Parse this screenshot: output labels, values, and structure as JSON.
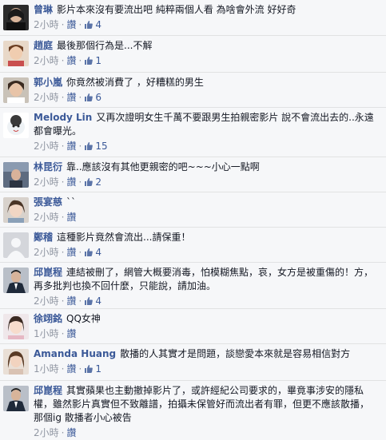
{
  "comments": [
    {
      "author": "曾琳",
      "text": "影片本來沒有要流出吧 純粹兩個人看 為啥會外流 好好奇",
      "time": "2小時",
      "like": "讚",
      "likes": "4"
    },
    {
      "author": "趙庭",
      "text": "最後那個行為是...不解",
      "time": "2小時",
      "like": "讚",
      "likes": "1"
    },
    {
      "author": "郭小嵐",
      "text": "你竟然被消費了 ，好糟糕的男生",
      "time": "2小時",
      "like": "讚",
      "likes": "6"
    },
    {
      "author": "Melody Lin",
      "text": "又再次證明女生千萬不要跟男生拍親密影片 說不會流出去的..永遠都會曝光。",
      "time": "2小時",
      "like": "讚",
      "likes": "15"
    },
    {
      "author": "林昆衍",
      "text": "靠..應該沒有其他更親密的吧~~~小心一點啊",
      "time": "2小時",
      "like": "讚",
      "likes": "2"
    },
    {
      "author": "張宴慈",
      "text": "``",
      "time": "2小時",
      "like": "讚",
      "likes": ""
    },
    {
      "author": "鄭稽",
      "text": "這種影片竟然會流出...請保重！",
      "time": "2小時",
      "like": "讚",
      "likes": "4"
    },
    {
      "author": "邱崑程",
      "text": "連結被刪了，網管大概要消毒，怕模糊焦點，哀，女方是被重傷的！方，再多批判也換不回什麼，只能說，請加油。",
      "time": "2小時",
      "like": "讚",
      "likes": "4"
    },
    {
      "author": "徐翊銘",
      "text": "QQ女神",
      "time": "1小時",
      "like": "讚",
      "likes": ""
    },
    {
      "author": "Amanda Huang",
      "text": "散播的人其實才是問題，談戀愛本來就是容易相信對方",
      "time": "1小時",
      "like": "讚",
      "likes": "1"
    },
    {
      "author": "邱崑程",
      "text": "其實蘋果也主動撤掉影片了，或許經紀公司要求的，畢竟事涉安的隱私權，雖然影片真實但不致離譜，拍攝未保管好而流出者有罪，但更不應該散播，那個ig 散播者小心被告",
      "time": "2小時",
      "like": "讚",
      "likes": ""
    }
  ],
  "colors": {
    "link": "#3b5998",
    "meta": "#9197a3",
    "bg": "#f6f7f9"
  },
  "icons": {
    "like": "thumbs-up-icon"
  }
}
